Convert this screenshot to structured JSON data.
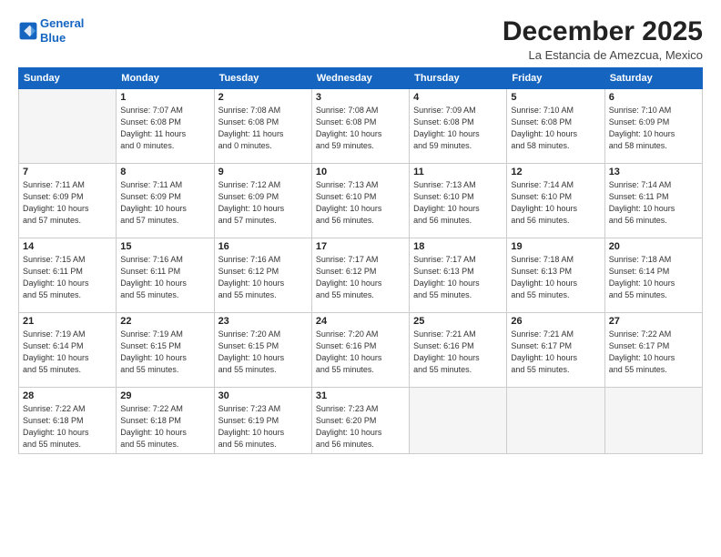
{
  "logo": {
    "line1": "General",
    "line2": "Blue"
  },
  "title": "December 2025",
  "location": "La Estancia de Amezcua, Mexico",
  "weekdays": [
    "Sunday",
    "Monday",
    "Tuesday",
    "Wednesday",
    "Thursday",
    "Friday",
    "Saturday"
  ],
  "weeks": [
    [
      {
        "day": "",
        "info": ""
      },
      {
        "day": "1",
        "info": "Sunrise: 7:07 AM\nSunset: 6:08 PM\nDaylight: 11 hours\nand 0 minutes."
      },
      {
        "day": "2",
        "info": "Sunrise: 7:08 AM\nSunset: 6:08 PM\nDaylight: 11 hours\nand 0 minutes."
      },
      {
        "day": "3",
        "info": "Sunrise: 7:08 AM\nSunset: 6:08 PM\nDaylight: 10 hours\nand 59 minutes."
      },
      {
        "day": "4",
        "info": "Sunrise: 7:09 AM\nSunset: 6:08 PM\nDaylight: 10 hours\nand 59 minutes."
      },
      {
        "day": "5",
        "info": "Sunrise: 7:10 AM\nSunset: 6:08 PM\nDaylight: 10 hours\nand 58 minutes."
      },
      {
        "day": "6",
        "info": "Sunrise: 7:10 AM\nSunset: 6:09 PM\nDaylight: 10 hours\nand 58 minutes."
      }
    ],
    [
      {
        "day": "7",
        "info": "Sunrise: 7:11 AM\nSunset: 6:09 PM\nDaylight: 10 hours\nand 57 minutes."
      },
      {
        "day": "8",
        "info": "Sunrise: 7:11 AM\nSunset: 6:09 PM\nDaylight: 10 hours\nand 57 minutes."
      },
      {
        "day": "9",
        "info": "Sunrise: 7:12 AM\nSunset: 6:09 PM\nDaylight: 10 hours\nand 57 minutes."
      },
      {
        "day": "10",
        "info": "Sunrise: 7:13 AM\nSunset: 6:10 PM\nDaylight: 10 hours\nand 56 minutes."
      },
      {
        "day": "11",
        "info": "Sunrise: 7:13 AM\nSunset: 6:10 PM\nDaylight: 10 hours\nand 56 minutes."
      },
      {
        "day": "12",
        "info": "Sunrise: 7:14 AM\nSunset: 6:10 PM\nDaylight: 10 hours\nand 56 minutes."
      },
      {
        "day": "13",
        "info": "Sunrise: 7:14 AM\nSunset: 6:11 PM\nDaylight: 10 hours\nand 56 minutes."
      }
    ],
    [
      {
        "day": "14",
        "info": "Sunrise: 7:15 AM\nSunset: 6:11 PM\nDaylight: 10 hours\nand 55 minutes."
      },
      {
        "day": "15",
        "info": "Sunrise: 7:16 AM\nSunset: 6:11 PM\nDaylight: 10 hours\nand 55 minutes."
      },
      {
        "day": "16",
        "info": "Sunrise: 7:16 AM\nSunset: 6:12 PM\nDaylight: 10 hours\nand 55 minutes."
      },
      {
        "day": "17",
        "info": "Sunrise: 7:17 AM\nSunset: 6:12 PM\nDaylight: 10 hours\nand 55 minutes."
      },
      {
        "day": "18",
        "info": "Sunrise: 7:17 AM\nSunset: 6:13 PM\nDaylight: 10 hours\nand 55 minutes."
      },
      {
        "day": "19",
        "info": "Sunrise: 7:18 AM\nSunset: 6:13 PM\nDaylight: 10 hours\nand 55 minutes."
      },
      {
        "day": "20",
        "info": "Sunrise: 7:18 AM\nSunset: 6:14 PM\nDaylight: 10 hours\nand 55 minutes."
      }
    ],
    [
      {
        "day": "21",
        "info": "Sunrise: 7:19 AM\nSunset: 6:14 PM\nDaylight: 10 hours\nand 55 minutes."
      },
      {
        "day": "22",
        "info": "Sunrise: 7:19 AM\nSunset: 6:15 PM\nDaylight: 10 hours\nand 55 minutes."
      },
      {
        "day": "23",
        "info": "Sunrise: 7:20 AM\nSunset: 6:15 PM\nDaylight: 10 hours\nand 55 minutes."
      },
      {
        "day": "24",
        "info": "Sunrise: 7:20 AM\nSunset: 6:16 PM\nDaylight: 10 hours\nand 55 minutes."
      },
      {
        "day": "25",
        "info": "Sunrise: 7:21 AM\nSunset: 6:16 PM\nDaylight: 10 hours\nand 55 minutes."
      },
      {
        "day": "26",
        "info": "Sunrise: 7:21 AM\nSunset: 6:17 PM\nDaylight: 10 hours\nand 55 minutes."
      },
      {
        "day": "27",
        "info": "Sunrise: 7:22 AM\nSunset: 6:17 PM\nDaylight: 10 hours\nand 55 minutes."
      }
    ],
    [
      {
        "day": "28",
        "info": "Sunrise: 7:22 AM\nSunset: 6:18 PM\nDaylight: 10 hours\nand 55 minutes."
      },
      {
        "day": "29",
        "info": "Sunrise: 7:22 AM\nSunset: 6:18 PM\nDaylight: 10 hours\nand 55 minutes."
      },
      {
        "day": "30",
        "info": "Sunrise: 7:23 AM\nSunset: 6:19 PM\nDaylight: 10 hours\nand 56 minutes."
      },
      {
        "day": "31",
        "info": "Sunrise: 7:23 AM\nSunset: 6:20 PM\nDaylight: 10 hours\nand 56 minutes."
      },
      {
        "day": "",
        "info": ""
      },
      {
        "day": "",
        "info": ""
      },
      {
        "day": "",
        "info": ""
      }
    ]
  ]
}
